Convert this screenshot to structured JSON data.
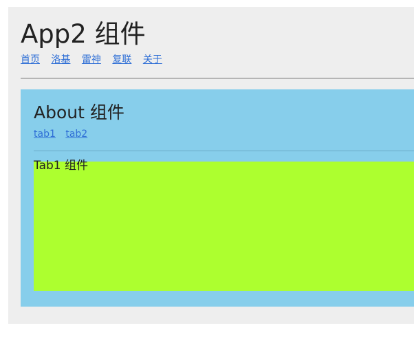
{
  "app": {
    "title": "App2 组件",
    "nav": [
      "首页",
      "洛基",
      "雷神",
      "复联",
      "关于"
    ]
  },
  "about": {
    "title": "About 组件",
    "tabs": [
      "tab1",
      "tab2"
    ],
    "active_tab_content": "Tab1 组件"
  },
  "colors": {
    "page_bg": "#eeeeee",
    "about_bg": "#87ceeb",
    "tab_bg": "#adff2f",
    "link": "#2f6fd6"
  }
}
